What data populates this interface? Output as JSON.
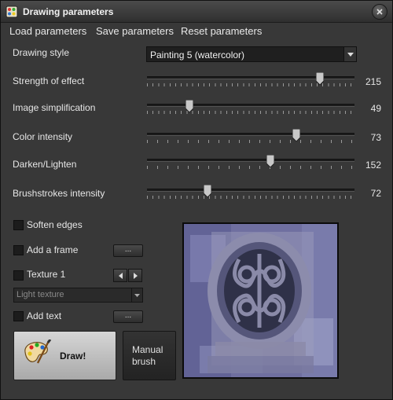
{
  "window": {
    "title": "Drawing parameters",
    "icon": "palette-app-icon",
    "close_icon": "close-icon"
  },
  "menu": [
    "Load parameters",
    "Save parameters",
    "Reset parameters"
  ],
  "drawing_style": {
    "label": "Drawing style",
    "value": "Painting 5 (watercolor)"
  },
  "sliders": [
    {
      "label": "Strength of effect",
      "value": "215",
      "fraction": 0.835
    },
    {
      "label": "Image simplification",
      "value": "49",
      "fraction": 0.205
    },
    {
      "label": "Color intensity",
      "value": "73",
      "fraction": 0.72
    },
    {
      "label": "Darken/Lighten",
      "value": "152",
      "fraction": 0.595
    },
    {
      "label": "Brushstrokes intensity",
      "value": "72",
      "fraction": 0.29
    }
  ],
  "options": {
    "soften_edges": "Soften edges",
    "add_frame": "Add a frame",
    "texture": "Texture 1",
    "texture_select": "Light texture",
    "add_text": "Add text",
    "ellipsis": "..."
  },
  "buttons": {
    "draw": "Draw!",
    "manual_brush": "Manual brush"
  },
  "colors": {
    "background": "#383838",
    "titlebar": "#3b3b3b",
    "preview_tint": "#6d6f9e"
  }
}
